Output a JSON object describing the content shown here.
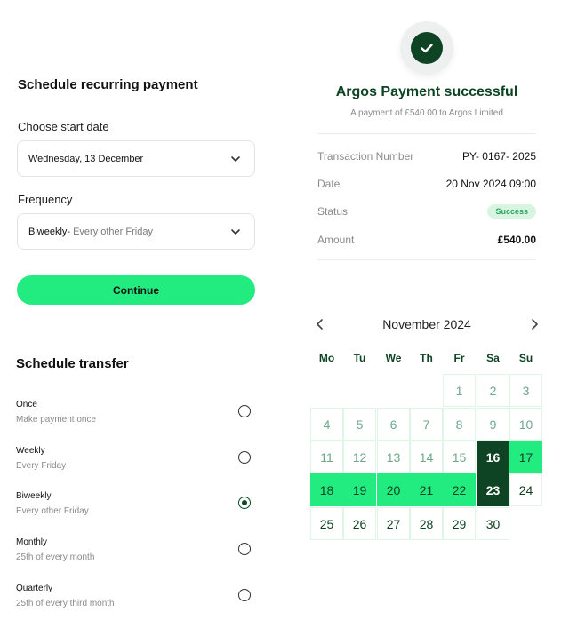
{
  "schedule": {
    "title": "Schedule recurring payment",
    "start_date_label": "Choose start date",
    "start_date_value": "Wednesday, 13 December",
    "frequency_label": "Frequency",
    "frequency_value": "Biweekly-",
    "frequency_detail": "Every other Friday",
    "continue_label": "Continue"
  },
  "transfer": {
    "title": "Schedule transfer",
    "options": [
      {
        "label": "Once",
        "sub": "Make payment once",
        "selected": false
      },
      {
        "label": "Weekly",
        "sub": "Every Friday",
        "selected": false
      },
      {
        "label": "Biweekly",
        "sub": "Every other Friday",
        "selected": true
      },
      {
        "label": "Monthly",
        "sub": "25th of every month",
        "selected": false
      },
      {
        "label": "Quarterly",
        "sub": "25th of every third month",
        "selected": false
      }
    ]
  },
  "success": {
    "icon": "check-icon",
    "title": "Argos Payment successful",
    "subtitle": "A payment of £540.00 to Argos Limited",
    "rows": [
      {
        "key": "Transaction Number",
        "value": "PY- 0167- 2025"
      },
      {
        "key": "Date",
        "value": "20 Nov 2024 09:00"
      },
      {
        "key": "Status",
        "value": "Success"
      },
      {
        "key": "Amount",
        "value": "£540.00"
      }
    ]
  },
  "calendar": {
    "month": "November 2024",
    "weekdays": [
      "Mo",
      "Tu",
      "We",
      "Th",
      "Fr",
      "Sa",
      "Su"
    ],
    "first_weekday_index": 4,
    "days_in_month": 30,
    "today": 16,
    "range_start": 16,
    "range_end": 23,
    "colors": {
      "accent": "#22ec80",
      "dark": "#0e4423",
      "muted": "#6ea88a"
    }
  }
}
